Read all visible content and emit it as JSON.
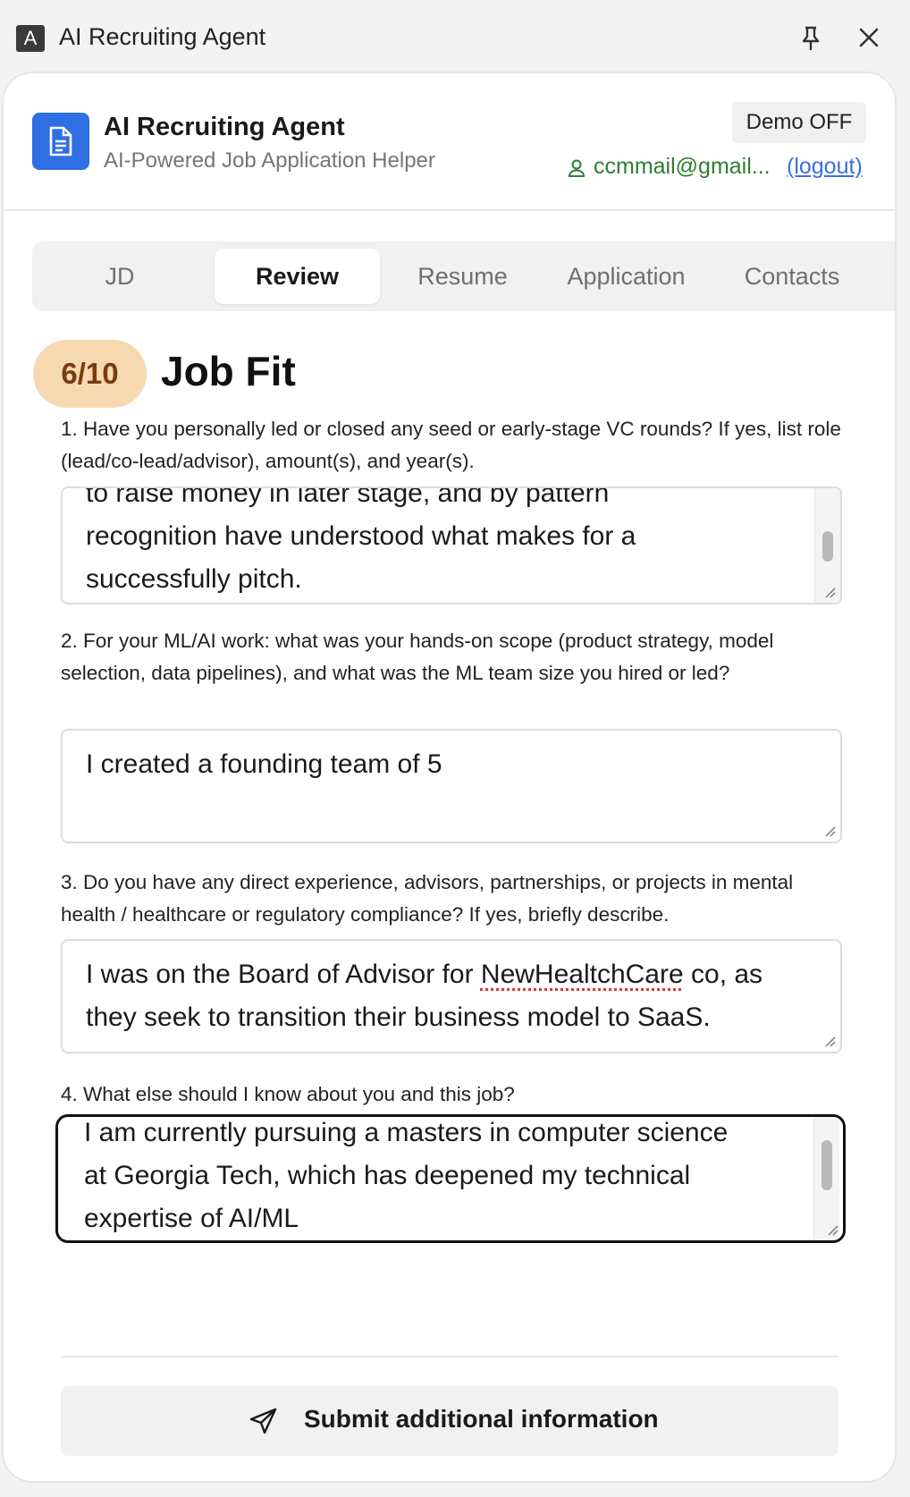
{
  "window": {
    "icon_letter": "A",
    "title": "AI Recruiting Agent"
  },
  "header": {
    "title": "AI Recruiting Agent",
    "subtitle": "AI-Powered Job Application Helper",
    "demo_label": "Demo OFF",
    "user_email": "ccmmail@gmail...",
    "logout_label": "(logout)"
  },
  "tabs": [
    {
      "label": "JD",
      "active": false
    },
    {
      "label": "Review",
      "active": true
    },
    {
      "label": "Resume",
      "active": false
    },
    {
      "label": "Application",
      "active": false
    },
    {
      "label": "Contacts",
      "active": false
    }
  ],
  "score": {
    "value": "6/10",
    "title": "Job Fit"
  },
  "questions": [
    {
      "question": "1. Have you personally led or closed any seed or early-stage VC rounds? If yes, list role (lead/co-lead/advisor), amount(s), and year(s).",
      "answer_lines": [
        "to raise money in later stage, and by pattern",
        "recognition have understood what makes for a",
        "successfully pitch."
      ]
    },
    {
      "question": "2. For your ML/AI work: what was your hands-on scope (product strategy, model selection, data pipelines), and what was the ML team size you hired or led?",
      "answer_lines": [
        "I created a founding team of 5"
      ]
    },
    {
      "question": "3. Do you have any direct experience, advisors, partnerships, or projects in mental health / healthcare or regulatory compliance? If yes, briefly describe.",
      "answer_lines": [
        "they seek to transition their business model to SaaS."
      ],
      "answer_first_line": {
        "before": "I was on the Board of Advisor for ",
        "misspelled": "NewHealtchCare",
        "after": " co, as"
      }
    },
    {
      "question": "4. What else should I know about you and this job?",
      "answer_lines": [
        "I am currently pursuing a masters in computer science",
        "at Georgia Tech, which has deepened my technical",
        "expertise of AI/ML"
      ]
    }
  ],
  "submit_label": "Submit additional information",
  "colors": {
    "accent": "#2f6fe4",
    "badge_bg": "#f7d9b1",
    "badge_text": "#7a3b10",
    "email": "#2e7d32",
    "link": "#3b6fe0"
  },
  "icons": {
    "app": "app-letter-icon",
    "pin": "pin-icon",
    "close": "close-icon",
    "logo": "document-icon",
    "user": "user-icon",
    "submit": "send-icon"
  }
}
